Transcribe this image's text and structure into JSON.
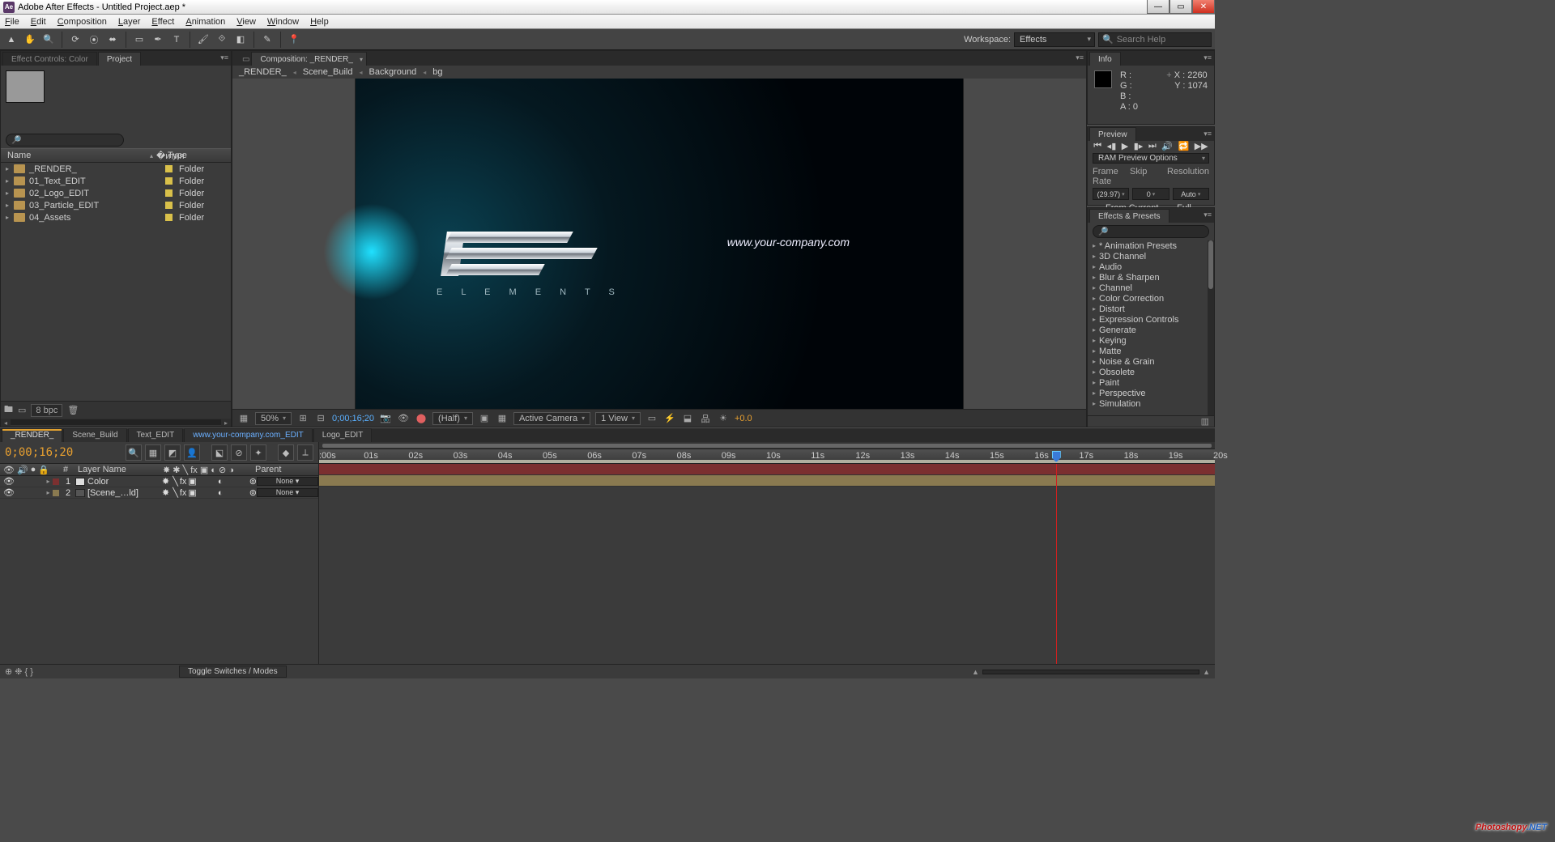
{
  "app": {
    "title": "Adobe After Effects - Untitled Project.aep *",
    "icon": "Ae"
  },
  "menu": [
    "File",
    "Edit",
    "Composition",
    "Layer",
    "Effect",
    "Animation",
    "View",
    "Window",
    "Help"
  ],
  "workspace": {
    "label": "Workspace:",
    "value": "Effects"
  },
  "search": {
    "placeholder": "Search Help"
  },
  "leftPanel": {
    "tabs": [
      "Effect Controls: Color",
      "Project"
    ],
    "activeTab": 1,
    "columns": {
      "name": "Name",
      "type": "Type"
    },
    "items": [
      {
        "name": "_RENDER_",
        "type": "Folder"
      },
      {
        "name": "01_Text_EDIT",
        "type": "Folder"
      },
      {
        "name": "02_Logo_EDIT",
        "type": "Folder"
      },
      {
        "name": "03_Particle_EDIT",
        "type": "Folder"
      },
      {
        "name": "04_Assets",
        "type": "Folder"
      }
    ],
    "bpc": "8 bpc"
  },
  "comp": {
    "tab": "Composition: _RENDER_",
    "flow": [
      "_RENDER_",
      "Scene_Build",
      "Background",
      "bg"
    ],
    "logoText": "E L E M E N T S",
    "urlText": "www.your-company.com",
    "footer": {
      "zoom": "50%",
      "timecode": "0;00;16;20",
      "res": "(Half)",
      "camera": "Active Camera",
      "views": "1 View",
      "exposure": "+0.0"
    }
  },
  "info": {
    "title": "Info",
    "R": "R :",
    "G": "G :",
    "B": "B :",
    "A": "A :  0",
    "X": "X : 2260",
    "Y": "Y : 1074"
  },
  "preview": {
    "title": "Preview",
    "ram": "RAM Preview Options",
    "headers": {
      "fr": "Frame Rate",
      "skip": "Skip",
      "res": "Resolution"
    },
    "values": {
      "fr": "(29.97)",
      "skip": "0",
      "res": "Auto"
    },
    "fromCurrent": "From Current Time",
    "fullScreen": "Full Screen"
  },
  "fx": {
    "title": "Effects & Presets",
    "items": [
      "* Animation Presets",
      "3D Channel",
      "Audio",
      "Blur & Sharpen",
      "Channel",
      "Color Correction",
      "Distort",
      "Expression Controls",
      "Generate",
      "Keying",
      "Matte",
      "Noise & Grain",
      "Obsolete",
      "Paint",
      "Perspective",
      "Simulation"
    ]
  },
  "timeline": {
    "tabs": [
      "_RENDER_",
      "Scene_Build",
      "Text_EDIT",
      "www.your-company.com_EDIT",
      "Logo_EDIT"
    ],
    "timecode": "0;00;16;20",
    "cols": {
      "hash": "#",
      "layerName": "Layer Name",
      "parent": "Parent"
    },
    "layers": [
      {
        "num": "1",
        "name": "Color",
        "color": "#7b3030",
        "parent": "None",
        "iconBg": "#ddd"
      },
      {
        "num": "2",
        "name": "[Scene_…ld]",
        "color": "#8a7a50",
        "parent": "None",
        "iconBg": "#555"
      }
    ],
    "seconds": [
      ":00s",
      "01s",
      "02s",
      "03s",
      "04s",
      "05s",
      "06s",
      "07s",
      "08s",
      "09s",
      "10s",
      "11s",
      "12s",
      "13s",
      "14s",
      "15s",
      "16s",
      "17s",
      "18s",
      "19s",
      "20s"
    ],
    "toggle": "Toggle Switches / Modes",
    "ctiPercent": 82.4
  },
  "watermark": {
    "a": "Photoshopy",
    "b": ".NET"
  }
}
